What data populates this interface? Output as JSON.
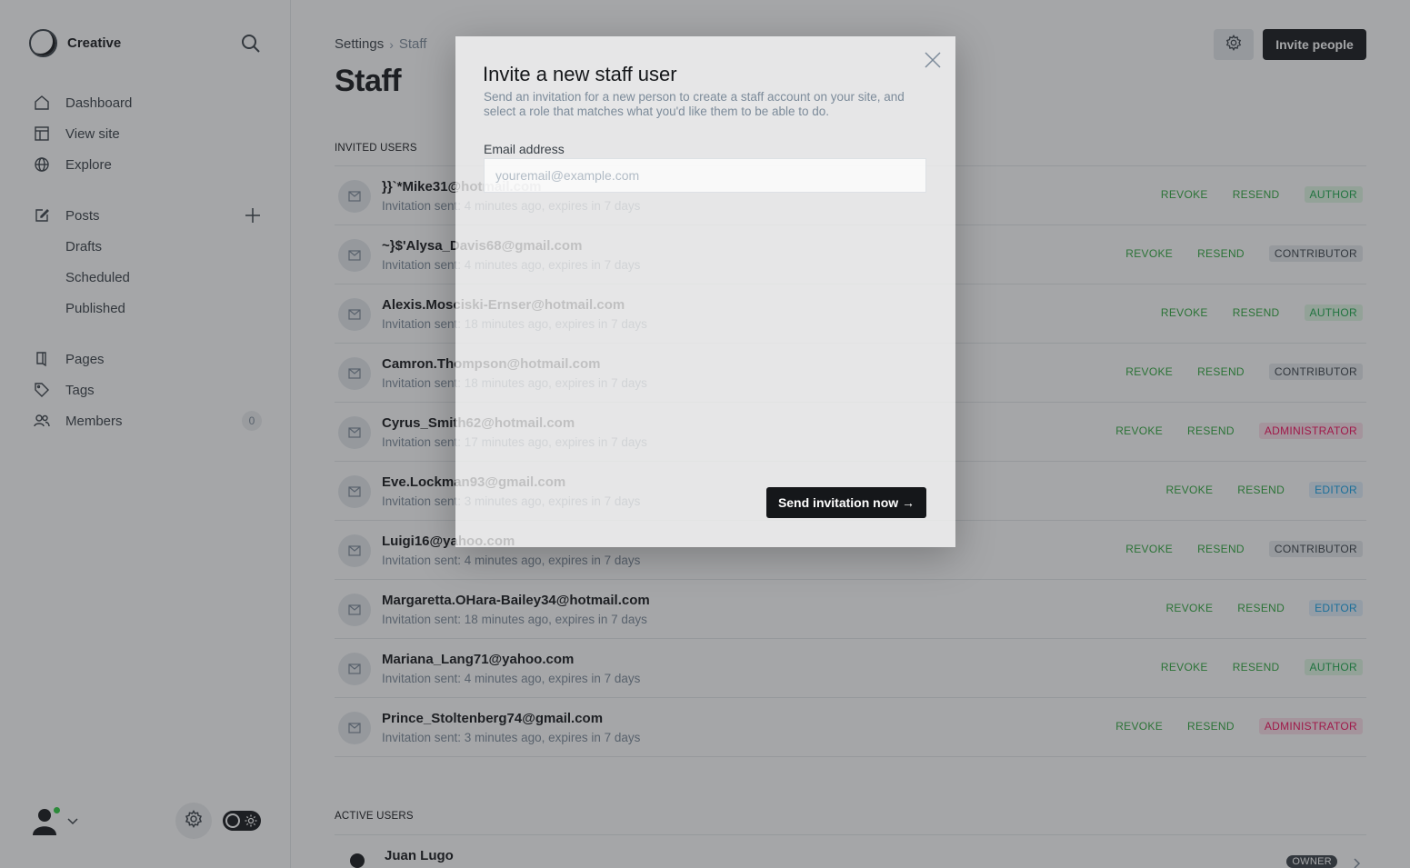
{
  "sidebar": {
    "brand": "Creative",
    "nav": [
      {
        "label": "Dashboard",
        "icon": "home-icon"
      },
      {
        "label": "View site",
        "icon": "layout-icon"
      },
      {
        "label": "Explore",
        "icon": "globe-icon"
      }
    ],
    "posts": {
      "label": "Posts",
      "sub": [
        "Drafts",
        "Scheduled",
        "Published"
      ]
    },
    "nav2": [
      {
        "label": "Pages",
        "icon": "page-icon"
      },
      {
        "label": "Tags",
        "icon": "tag-icon"
      },
      {
        "label": "Members",
        "icon": "members-icon",
        "count": "0"
      }
    ]
  },
  "header": {
    "breadcrumb": [
      "Settings",
      "Staff"
    ],
    "title": "Staff",
    "invite_label": "Invite people"
  },
  "invited": {
    "section_label": "INVITED USERS",
    "action_revoke": "REVOKE",
    "action_resend": "RESEND",
    "rows": [
      {
        "email": "}}`*Mike31@hotmail.com",
        "meta": "Invitation sent: 4 minutes ago, expires in 7 days",
        "role": "AUTHOR",
        "role_kind": "author"
      },
      {
        "email": "~}$'Alysa_Davis68@gmail.com",
        "meta": "Invitation sent: 4 minutes ago, expires in 7 days",
        "role": "CONTRIBUTOR",
        "role_kind": "contributor"
      },
      {
        "email": "Alexis.Mosciski-Ernser@hotmail.com",
        "meta": "Invitation sent: 18 minutes ago, expires in 7 days",
        "role": "AUTHOR",
        "role_kind": "author"
      },
      {
        "email": "Camron.Thompson@hotmail.com",
        "meta": "Invitation sent: 18 minutes ago, expires in 7 days",
        "role": "CONTRIBUTOR",
        "role_kind": "contributor"
      },
      {
        "email": "Cyrus_Smith62@hotmail.com",
        "meta": "Invitation sent: 17 minutes ago, expires in 7 days",
        "role": "ADMINISTRATOR",
        "role_kind": "administrator"
      },
      {
        "email": "Eve.Lockman93@gmail.com",
        "meta": "Invitation sent: 3 minutes ago, expires in 7 days",
        "role": "EDITOR",
        "role_kind": "editor"
      },
      {
        "email": "Luigi16@yahoo.com",
        "meta": "Invitation sent: 4 minutes ago, expires in 7 days",
        "role": "CONTRIBUTOR",
        "role_kind": "contributor"
      },
      {
        "email": "Margaretta.OHara-Bailey34@hotmail.com",
        "meta": "Invitation sent: 18 minutes ago, expires in 7 days",
        "role": "EDITOR",
        "role_kind": "editor"
      },
      {
        "email": "Mariana_Lang71@yahoo.com",
        "meta": "Invitation sent: 4 minutes ago, expires in 7 days",
        "role": "AUTHOR",
        "role_kind": "author"
      },
      {
        "email": "Prince_Stoltenberg74@gmail.com",
        "meta": "Invitation sent: 3 minutes ago, expires in 7 days",
        "role": "ADMINISTRATOR",
        "role_kind": "administrator"
      }
    ]
  },
  "active": {
    "section_label": "ACTIVE USERS",
    "rows": [
      {
        "name": "Juan Lugo",
        "role": "OWNER"
      }
    ]
  },
  "modal": {
    "title": "Invite a new staff user",
    "description": "Send an invitation for a new person to create a staff account on your site, and select a role that matches what you'd like them to be able to do.",
    "email_label": "Email address",
    "email_placeholder": "youremail@example.com",
    "email_value": "",
    "send_label": "Send invitation now →"
  }
}
